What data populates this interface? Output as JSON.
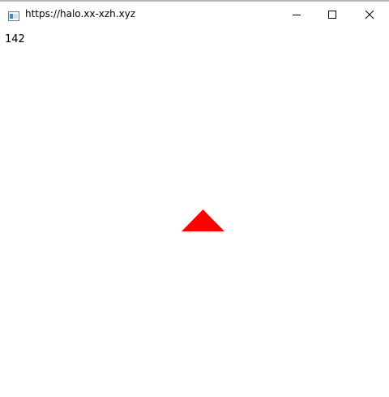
{
  "window": {
    "title": "https://halo.xx-xzh.xyz",
    "icons": {
      "app": "browser-page-icon",
      "minimize": "minimize-icon",
      "maximize": "maximize-icon",
      "close": "close-icon"
    }
  },
  "content": {
    "counter": "142",
    "shape": {
      "type": "triangle",
      "color": "#ff0000"
    }
  }
}
